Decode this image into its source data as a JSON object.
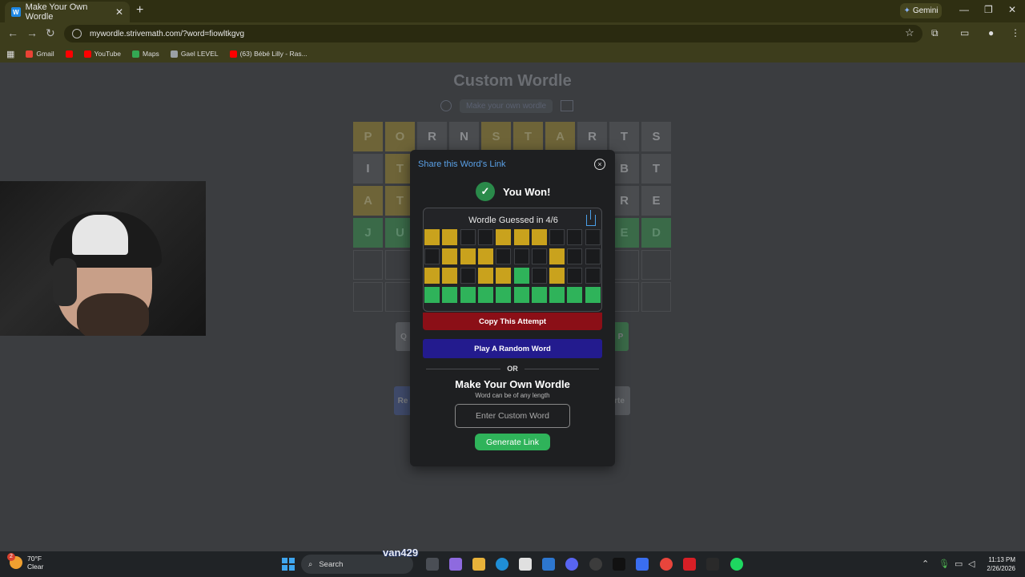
{
  "browser": {
    "tab_title": "Make Your Own Wordle",
    "tab_favicon": "W",
    "new_tab": "+",
    "gemini_label": "Gemini",
    "url": "mywordle.strivemath.com/?word=fiowltkgvg",
    "bookmarks": [
      {
        "label": "Gmail",
        "color": "#ea4335"
      },
      {
        "label": "YouTube",
        "color": "#ff0000"
      },
      {
        "label": "Maps",
        "color": "#34a853"
      },
      {
        "label": "Gael LEVEL",
        "color": "#9aa0a6"
      },
      {
        "label": "(63) Bébé Lilly - Ras...",
        "color": "#ff0000"
      }
    ]
  },
  "page": {
    "title": "Custom Wordle",
    "subtitle": "Make your own wordle",
    "board": [
      [
        {
          "l": "P",
          "s": "y"
        },
        {
          "l": "O",
          "s": "y"
        },
        {
          "l": "R",
          "s": "d"
        },
        {
          "l": "N",
          "s": "d"
        },
        {
          "l": "S",
          "s": "y"
        },
        {
          "l": "T",
          "s": "y"
        },
        {
          "l": "A",
          "s": "y"
        },
        {
          "l": "R",
          "s": "d"
        },
        {
          "l": "T",
          "s": "d"
        },
        {
          "l": "S",
          "s": "d"
        }
      ],
      [
        {
          "l": "I",
          "s": "d"
        },
        {
          "l": "T",
          "s": "y"
        },
        {
          "l": "",
          "s": "y"
        },
        {
          "l": "",
          "s": "y"
        },
        {
          "l": "",
          "s": "d"
        },
        {
          "l": "",
          "s": "d"
        },
        {
          "l": "",
          "s": "d"
        },
        {
          "l": "",
          "s": "y"
        },
        {
          "l": "B",
          "s": "d"
        },
        {
          "l": "T",
          "s": "d"
        }
      ],
      [
        {
          "l": "A",
          "s": "y"
        },
        {
          "l": "T",
          "s": "y"
        },
        {
          "l": "",
          "s": "d"
        },
        {
          "l": "",
          "s": "y"
        },
        {
          "l": "",
          "s": "y"
        },
        {
          "l": "",
          "s": "g"
        },
        {
          "l": "",
          "s": "d"
        },
        {
          "l": "",
          "s": "y"
        },
        {
          "l": "R",
          "s": "d"
        },
        {
          "l": "E",
          "s": "d"
        }
      ],
      [
        {
          "l": "J",
          "s": "g"
        },
        {
          "l": "U",
          "s": "g"
        },
        {
          "l": "",
          "s": "g"
        },
        {
          "l": "",
          "s": "g"
        },
        {
          "l": "",
          "s": "g"
        },
        {
          "l": "",
          "s": "g"
        },
        {
          "l": "",
          "s": "g"
        },
        {
          "l": "",
          "s": "g"
        },
        {
          "l": "E",
          "s": "g"
        },
        {
          "l": "D",
          "s": "g"
        }
      ],
      [
        {
          "l": "",
          "s": "e"
        },
        {
          "l": "",
          "s": "e"
        },
        {
          "l": "",
          "s": "e"
        },
        {
          "l": "",
          "s": "e"
        },
        {
          "l": "",
          "s": "e"
        },
        {
          "l": "",
          "s": "e"
        },
        {
          "l": "",
          "s": "e"
        },
        {
          "l": "",
          "s": "e"
        },
        {
          "l": "",
          "s": "e"
        },
        {
          "l": "",
          "s": "e"
        }
      ],
      [
        {
          "l": "",
          "s": "e"
        },
        {
          "l": "",
          "s": "e"
        },
        {
          "l": "",
          "s": "e"
        },
        {
          "l": "",
          "s": "e"
        },
        {
          "l": "",
          "s": "e"
        },
        {
          "l": "",
          "s": "e"
        },
        {
          "l": "",
          "s": "e"
        },
        {
          "l": "",
          "s": "e"
        },
        {
          "l": "",
          "s": "e"
        },
        {
          "l": "",
          "s": "e"
        }
      ]
    ],
    "keyboard_fragments": [
      {
        "label": "Q",
        "color": "#55585c"
      },
      {
        "label": "P",
        "color": "#3a6a48"
      },
      {
        "label": "Re",
        "color": "#3f4a6a"
      },
      {
        "label": "rte",
        "color": "#55585c"
      }
    ]
  },
  "modal": {
    "share_link": "Share this Word's Link",
    "close_icon": "×",
    "won_check": "✓",
    "won_text": "You Won!",
    "guessed_text": "Wordle Guessed in 4/6",
    "result_grid": [
      [
        "y",
        "y",
        "b",
        "b",
        "y",
        "y",
        "y",
        "b",
        "b",
        "b"
      ],
      [
        "b",
        "y",
        "y",
        "y",
        "b",
        "b",
        "b",
        "y",
        "b",
        "b"
      ],
      [
        "y",
        "y",
        "b",
        "y",
        "y",
        "g",
        "b",
        "y",
        "b",
        "b"
      ],
      [
        "g",
        "g",
        "g",
        "g",
        "g",
        "g",
        "g",
        "g",
        "g",
        "g"
      ]
    ],
    "copy_button": "Copy This Attempt",
    "random_button": "Play A Random Word",
    "or_text": "OR",
    "make_title": "Make Your Own Wordle",
    "length_note": "Word can be of any length",
    "input_placeholder": "Enter Custom Word",
    "generate_button": "Generate Link"
  },
  "taskbar": {
    "temperature": "70°F",
    "condition": "Clear",
    "weather_badge": "2",
    "search_label": "Search",
    "overlay_name": "van429",
    "time": "11:13 PM",
    "date": "2/26/2026"
  }
}
